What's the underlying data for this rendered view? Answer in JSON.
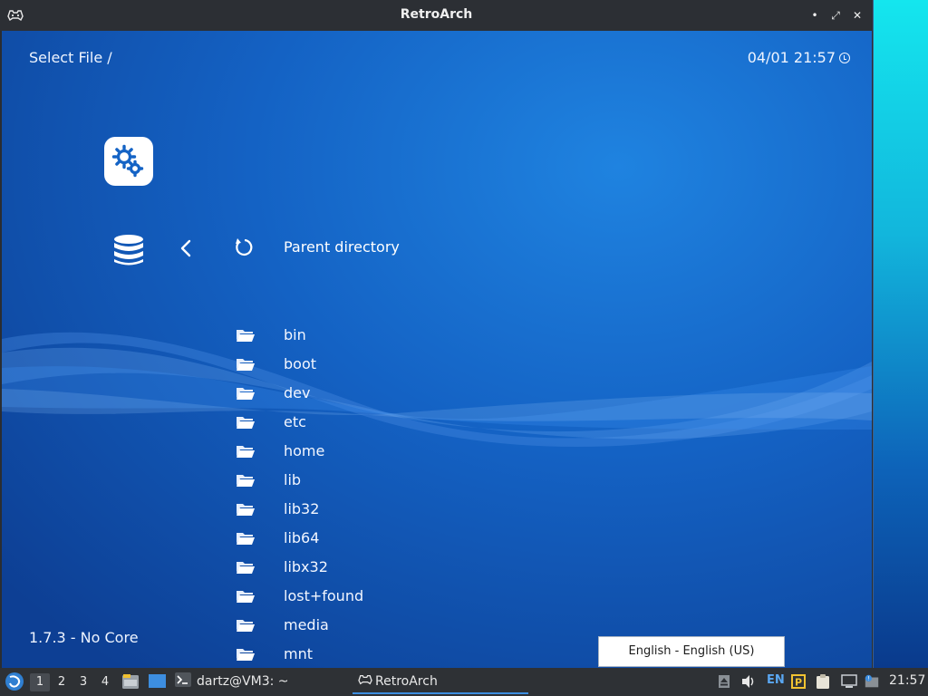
{
  "window": {
    "title": "RetroArch",
    "buttons": {
      "minimize": "•",
      "maximize": "⤢",
      "close": "✕"
    }
  },
  "header": {
    "title": "Select File /",
    "datetime": "04/01 21:57"
  },
  "menu": {
    "parent_label": "Parent directory",
    "files": [
      "bin",
      "boot",
      "dev",
      "etc",
      "home",
      "lib",
      "lib32",
      "lib64",
      "libx32",
      "lost+found",
      "media",
      "mnt"
    ]
  },
  "footer": {
    "core": "1.7.3 - No Core"
  },
  "ime_popup": {
    "label": "English - English (US)"
  },
  "taskbar": {
    "workspaces": [
      "1",
      "2",
      "3",
      "4"
    ],
    "active_workspace": "1",
    "tasks": [
      {
        "label": "dartz@VM3: ~",
        "icon": "terminal-icon"
      },
      {
        "label": "RetroArch",
        "icon": "gamepad-icon"
      }
    ],
    "language": "EN",
    "clock": "21:57"
  },
  "colors": {
    "accent": "#3d8ee0",
    "content_bg": "#1462c4",
    "taskbar_bg": "#2e3135"
  }
}
